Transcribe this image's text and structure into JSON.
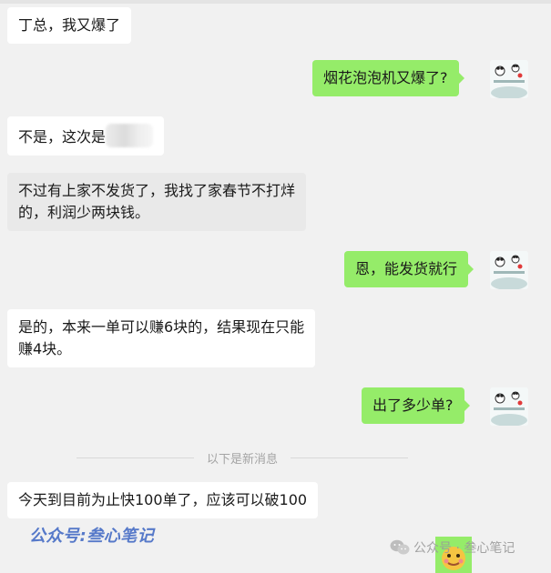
{
  "messages": [
    {
      "side": "in",
      "text": "丁总，我又爆了"
    },
    {
      "side": "out",
      "text": "烟花泡泡机又爆了?"
    },
    {
      "side": "in",
      "text": "不是，这次是"
    },
    {
      "side": "in",
      "lines": [
        "不过有上家不发货了，我找了家春节不打烊",
        "的，利润少两块钱。"
      ]
    },
    {
      "side": "out",
      "text": "恩，能发货就行"
    },
    {
      "side": "in",
      "lines": [
        "是的，本来一单可以赚6块的，结果现在只能",
        "赚4块。"
      ]
    },
    {
      "side": "out",
      "text": "出了多少单?"
    },
    {
      "side": "in",
      "text": "今天到目前为止快100单了，应该可以破100"
    }
  ],
  "divider_text": "以下是新消息",
  "watermark_left": "公众号:叁心笔记",
  "watermark_right": "公众号 · 叁心笔记",
  "colors": {
    "outgoing": "#95ec69",
    "incoming": "#ffffff",
    "background": "#f1f1f1"
  },
  "icons": {
    "avatar": "panda-avatar-icon",
    "wechat": "wechat-logo-icon"
  }
}
